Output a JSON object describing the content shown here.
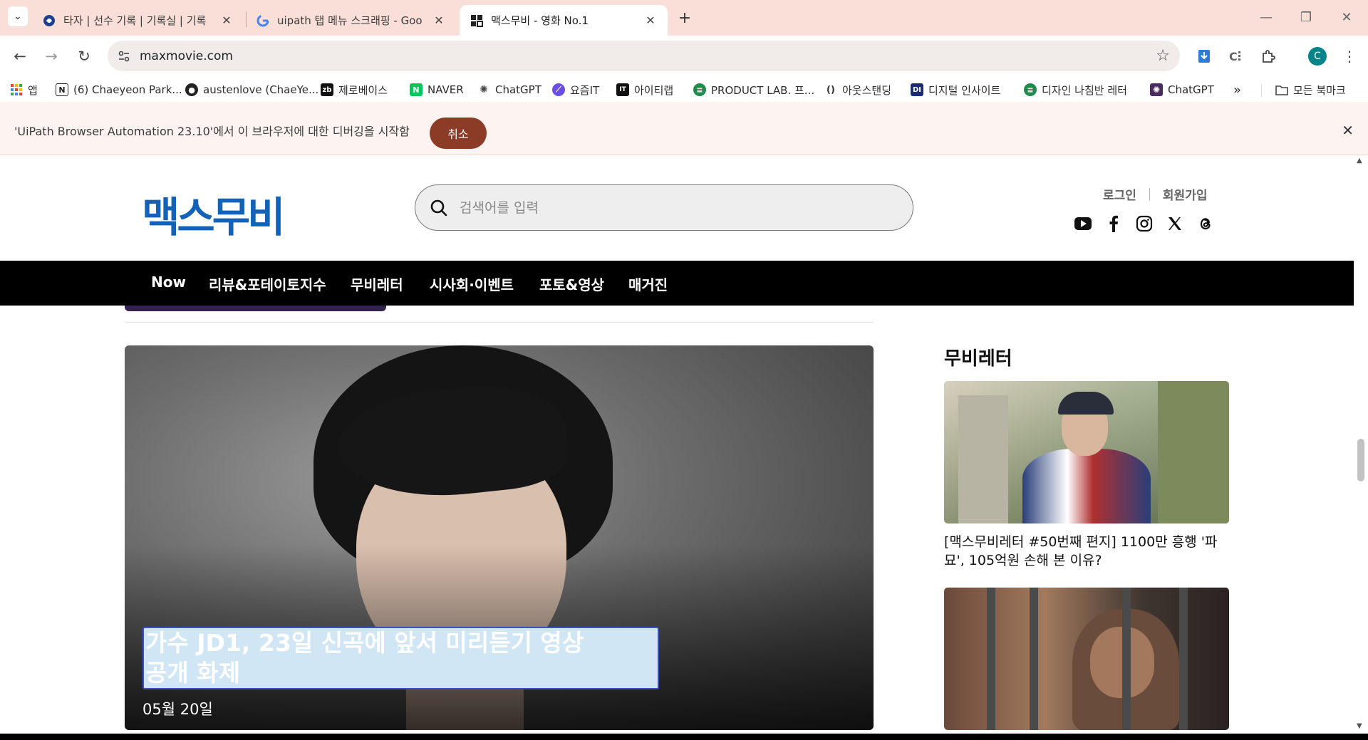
{
  "browser": {
    "tabs": [
      {
        "title": "타자 | 선수 기록 | 기록실 | 기록",
        "active": false
      },
      {
        "title": "uipath 탭 메뉴 스크래핑 - Goo",
        "active": false
      },
      {
        "title": "맥스무비 - 영화 No.1",
        "active": true
      }
    ],
    "url": "maxmovie.com",
    "profile_initial": "C"
  },
  "bookmarks": [
    {
      "label": "앱",
      "icon": "apps-grid-icon"
    },
    {
      "label": "(6) Chaeyeon Park...",
      "icon": "notion-icon"
    },
    {
      "label": "austenlove (ChaeYe...",
      "icon": "github-icon"
    },
    {
      "label": "제로베이스",
      "icon": "zerobase-icon"
    },
    {
      "label": "NAVER",
      "icon": "naver-icon"
    },
    {
      "label": "ChatGPT",
      "icon": "chatgpt-icon"
    },
    {
      "label": "요즘IT",
      "icon": "yozmit-icon"
    },
    {
      "label": "아이티랩",
      "icon": "itlab-icon"
    },
    {
      "label": "PRODUCT LAB. 프...",
      "icon": "productlab-icon"
    },
    {
      "label": "아웃스탠딩",
      "icon": "outstanding-icon"
    },
    {
      "label": "디지털 인사이트",
      "icon": "digital-insight-icon"
    },
    {
      "label": "디자인 나침반 레터",
      "icon": "design-compass-icon"
    },
    {
      "label": "ChatGPT",
      "icon": "chatgpt-icon"
    }
  ],
  "bookmarks_all_label": "모든 북마크",
  "infobar": {
    "text": "'UiPath Browser Automation 23.10'에서 이 브라우저에 대한 디버깅을 시작함",
    "cancel_label": "취소"
  },
  "site": {
    "logo": "맥스무비",
    "search_placeholder": "검색어를 입력",
    "login": "로그인",
    "signup": "회원가입",
    "socials": [
      "youtube-icon",
      "facebook-icon",
      "instagram-icon",
      "x-icon",
      "threads-icon"
    ],
    "nav": [
      "Now",
      "리뷰&포테이토지수",
      "무비레터",
      "시사회·이벤트",
      "포토&영상",
      "매거진"
    ]
  },
  "hero": {
    "title_line1": "가수 JD1, 23일 신곡에 앞서 미리듣기 영상",
    "title_line2": "공개 화제",
    "date": "05월 20일"
  },
  "sidebar": {
    "heading": "무비레터",
    "cards": [
      {
        "title_line1": "[맥스무비레터 #50번째 편지] 1100만 흥행 '파",
        "title_line2": "묘', 105억원 손해 본 이유?"
      }
    ]
  },
  "colors": {
    "tabstrip": "#f9dfd7",
    "logo_blue": "#1262b8",
    "cancel_button": "#8c3b26",
    "nav_bar": "#000000"
  }
}
